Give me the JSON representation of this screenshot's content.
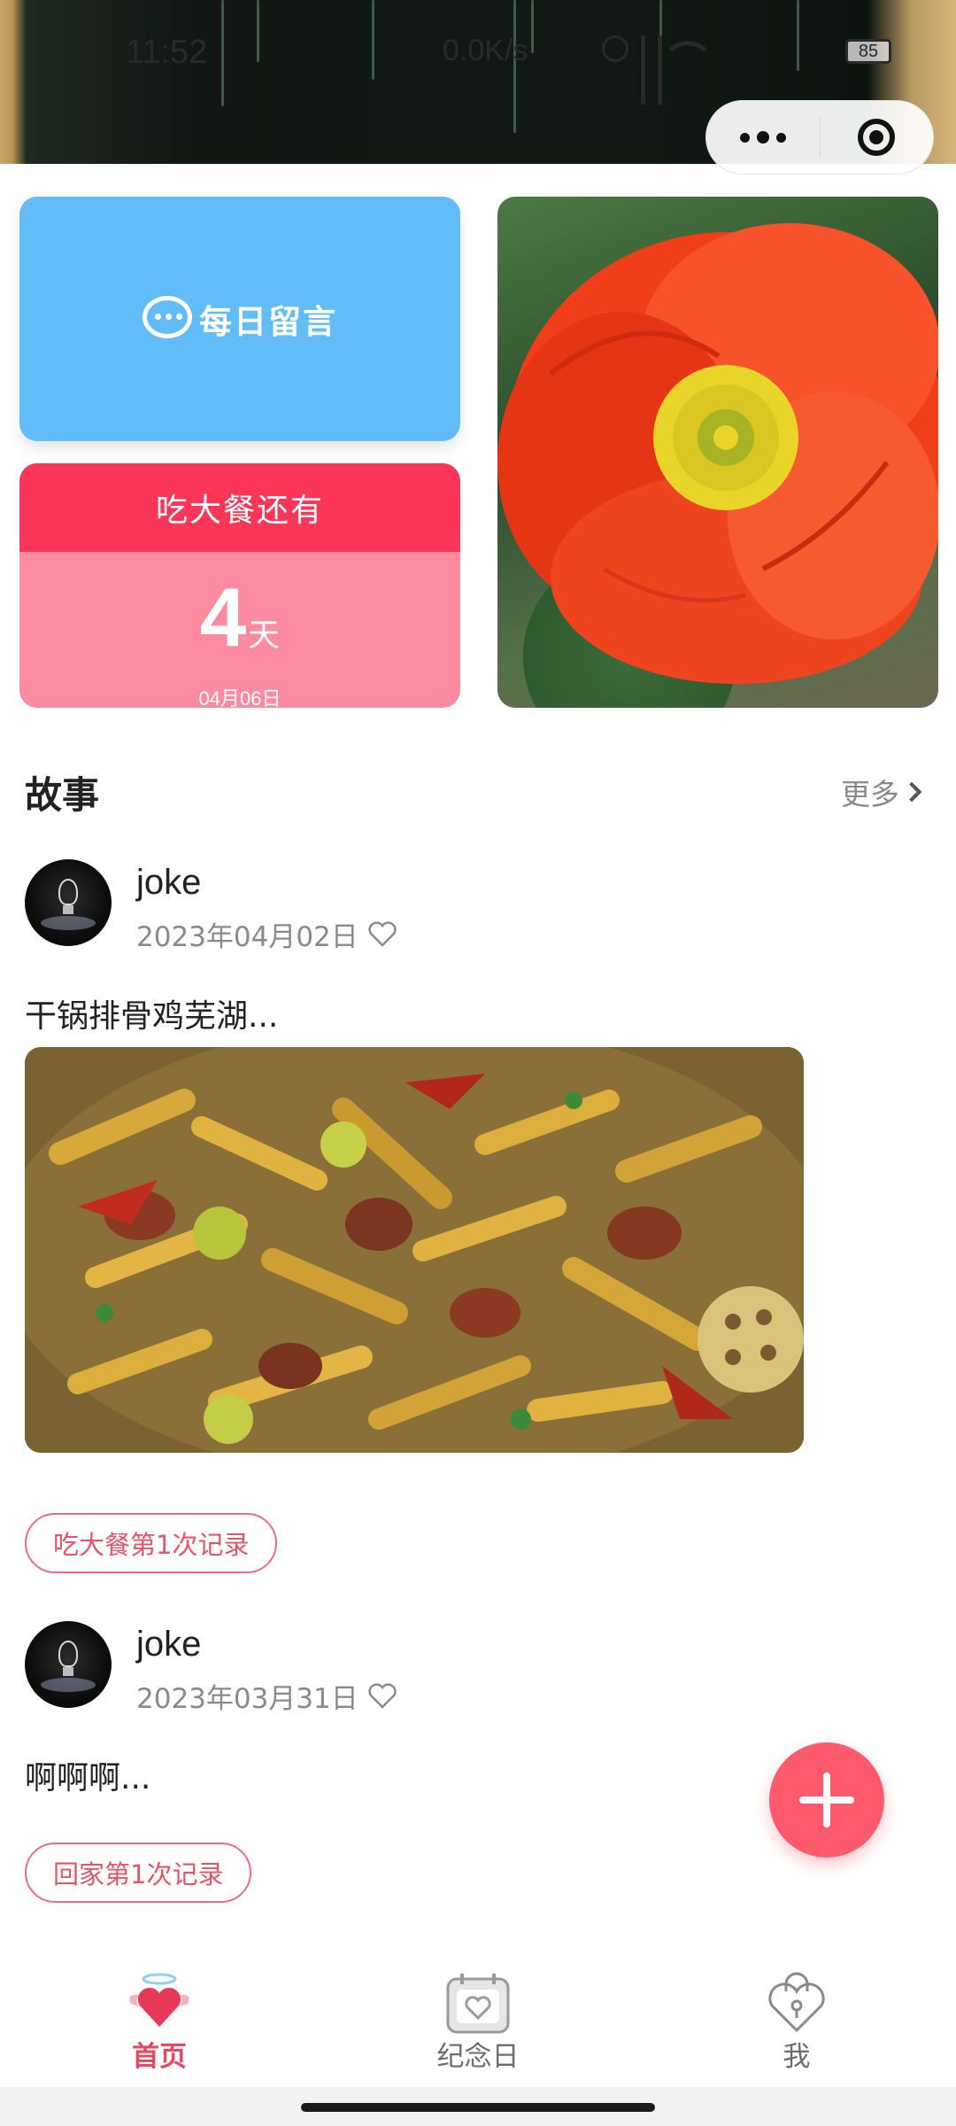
{
  "status_bar": {
    "time": "11:52",
    "net_speed": "0.0K/s",
    "battery": "85"
  },
  "capsule": {
    "more_icon": "more-dots-icon",
    "close_icon": "target-circle-icon"
  },
  "message_card": {
    "icon": "chat-bubble-icon",
    "label": "每日留言"
  },
  "countdown": {
    "header": "吃大餐还有",
    "number": "4",
    "unit": "天",
    "date": "04月06日"
  },
  "stories": {
    "title": "故事",
    "more": "更多",
    "posts": [
      {
        "author": "joke",
        "date": "2023年04月02日",
        "text": "干锅排骨鸡芜湖...",
        "has_image": true,
        "tag": "吃大餐第1次记录"
      },
      {
        "author": "joke",
        "date": "2023年03月31日",
        "text": "啊啊啊...",
        "has_image": false,
        "tag": "回家第1次记录"
      }
    ]
  },
  "fab": {
    "icon": "plus-icon"
  },
  "colors": {
    "accent": "#fd5a6d",
    "message_card": "#62bcf8",
    "countdown_head": "#fc3659",
    "countdown_body": "#fd8ba0"
  },
  "tabbar": {
    "items": [
      {
        "label": "首页",
        "icon": "winged-heart-icon",
        "active": true
      },
      {
        "label": "纪念日",
        "icon": "calendar-heart-icon",
        "active": false
      },
      {
        "label": "我",
        "icon": "heart-lock-icon",
        "active": false
      }
    ]
  }
}
